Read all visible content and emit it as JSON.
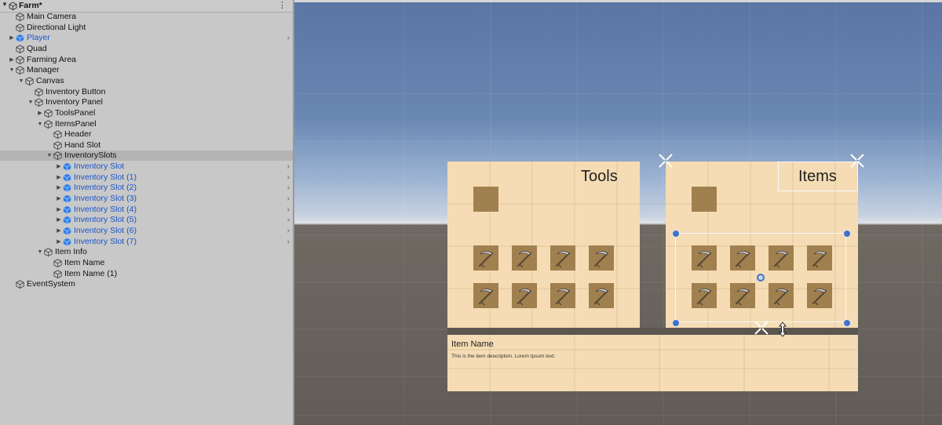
{
  "hierarchy": {
    "scene_name": "Farm*",
    "menu_icon": "kebab-menu-icon",
    "items": [
      {
        "label": "Main Camera",
        "fold": "",
        "blue": false,
        "more": false
      },
      {
        "label": "Directional Light",
        "fold": "",
        "blue": false,
        "more": false
      },
      {
        "label": "Player",
        "fold": "right",
        "blue": true,
        "more": true
      },
      {
        "label": "Quad",
        "fold": "",
        "blue": false,
        "more": false
      },
      {
        "label": "Farming Area",
        "fold": "right",
        "blue": false,
        "more": false
      },
      {
        "label": "Manager",
        "fold": "down",
        "blue": false,
        "more": false
      },
      {
        "label": "Canvas",
        "fold": "down",
        "blue": false,
        "more": false
      },
      {
        "label": "Inventory Button",
        "fold": "",
        "blue": false,
        "more": false
      },
      {
        "label": "Inventory Panel",
        "fold": "down",
        "blue": false,
        "more": false
      },
      {
        "label": "ToolsPanel",
        "fold": "right",
        "blue": false,
        "more": false
      },
      {
        "label": "ItemsPanel",
        "fold": "down",
        "blue": false,
        "more": false
      },
      {
        "label": "Header",
        "fold": "",
        "blue": false,
        "more": false
      },
      {
        "label": "Hand Slot",
        "fold": "",
        "blue": false,
        "more": false
      },
      {
        "label": "InventorySlots",
        "fold": "down",
        "blue": false,
        "more": false,
        "selected": true
      },
      {
        "label": "Inventory Slot",
        "fold": "right",
        "blue": true,
        "more": true
      },
      {
        "label": "Inventory Slot (1)",
        "fold": "right",
        "blue": true,
        "more": true
      },
      {
        "label": "Inventory Slot (2)",
        "fold": "right",
        "blue": true,
        "more": true
      },
      {
        "label": "Inventory Slot (3)",
        "fold": "right",
        "blue": true,
        "more": true
      },
      {
        "label": "Inventory Slot (4)",
        "fold": "right",
        "blue": true,
        "more": true
      },
      {
        "label": "Inventory Slot (5)",
        "fold": "right",
        "blue": true,
        "more": true
      },
      {
        "label": "Inventory Slot (6)",
        "fold": "right",
        "blue": true,
        "more": true
      },
      {
        "label": "Inventory Slot (7)",
        "fold": "right",
        "blue": true,
        "more": true
      },
      {
        "label": "Item Info",
        "fold": "down",
        "blue": false,
        "more": false
      },
      {
        "label": "Item Name",
        "fold": "",
        "blue": false,
        "more": false
      },
      {
        "label": "Item Name (1)",
        "fold": "",
        "blue": false,
        "more": false
      },
      {
        "label": "EventSystem",
        "fold": "",
        "blue": false,
        "more": false
      }
    ]
  },
  "scene": {
    "tools_title": "Tools",
    "items_title": "Items",
    "item_name": "Item Name",
    "item_description": "This is the item description. Lorem Ipsum text.",
    "colors": {
      "panel": "#f5dcb4",
      "slot": "#a0804e",
      "selection_handle": "#3f72c9",
      "prefab_blue": "#1a56c8"
    }
  }
}
